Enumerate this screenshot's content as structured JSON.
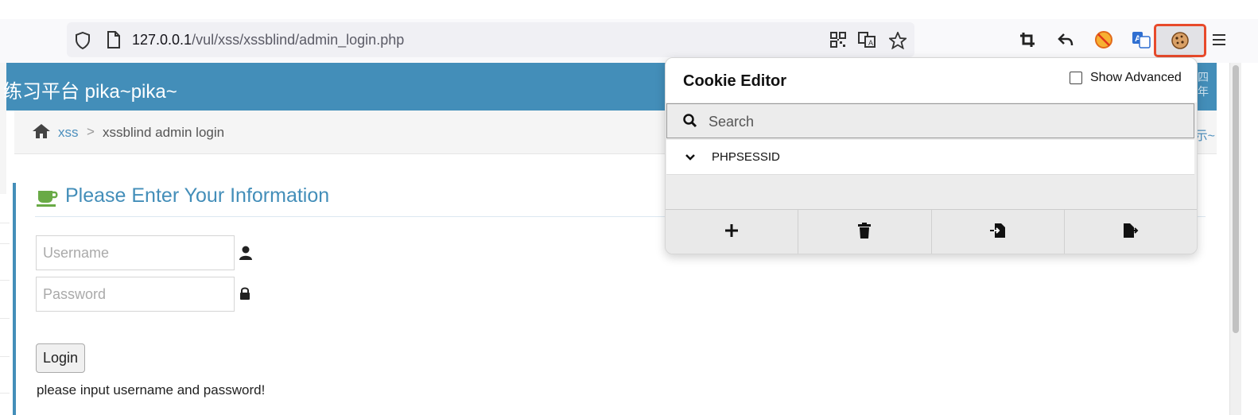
{
  "browser": {
    "url_host": "127.0.0.1",
    "url_path": "/vul/xss/xssblind/admin_login.php",
    "icons": [
      "shield-icon",
      "page-icon",
      "qr-code-icon",
      "translate-icon",
      "bookmark-star-icon",
      "crop-icon",
      "back-arrow-icon",
      "blocked-extension-icon",
      "translate-extension-icon",
      "cookie-icon",
      "menu-icon"
    ],
    "highlight_color": "#e84a2b"
  },
  "header": {
    "brand": "练习平台 pika~pika~",
    "right_text_line1": "四",
    "right_text_line2": "年"
  },
  "breadcrumb": {
    "item1": "xss",
    "separator": ">",
    "item2": "xssblind admin login",
    "right_tip": "示~"
  },
  "form": {
    "title": "Please Enter Your Information",
    "username_placeholder": "Username",
    "password_placeholder": "Password",
    "login_label": "Login",
    "message": "please input username and password!"
  },
  "cookie_editor": {
    "title": "Cookie Editor",
    "show_advanced_label": "Show Advanced",
    "show_advanced_checked": false,
    "search_placeholder": "Search",
    "cookies": [
      "PHPSESSID"
    ],
    "actions": [
      "add-icon",
      "delete-icon",
      "import-icon",
      "export-icon"
    ]
  },
  "colors": {
    "header_blue": "#438eb9",
    "link_blue": "#4c8fbd"
  }
}
